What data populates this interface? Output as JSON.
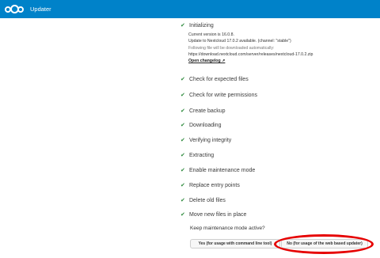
{
  "header": {
    "title": "Updater"
  },
  "steps": [
    "Initializing",
    "Check for expected files",
    "Check for write permissions",
    "Create backup",
    "Downloading",
    "Verifying integrity",
    "Extracting",
    "Enable maintenance mode",
    "Replace entry points",
    "Delete old files",
    "Move new files in place"
  ],
  "details": {
    "current_version": "Current version is 16.0.8.",
    "update_available": "Update to Nextcloud 17.0.2 available. (channel: \"stable\")",
    "download_note": "Following file will be downloaded automatically:",
    "download_url": "https://download.nextcloud.com/server/releases/nextcloud-17.0.2.zip",
    "changelog_link": "Open changelog ↗"
  },
  "maintenance": {
    "question": "Keep maintenance mode active?",
    "yes_label": "Yes (for usage with command line tool)",
    "no_label": "No (for usage of the web based updater)"
  },
  "colors": {
    "header_bg": "#0082c9",
    "check": "#2e8b3d",
    "highlight": "#e60000"
  }
}
